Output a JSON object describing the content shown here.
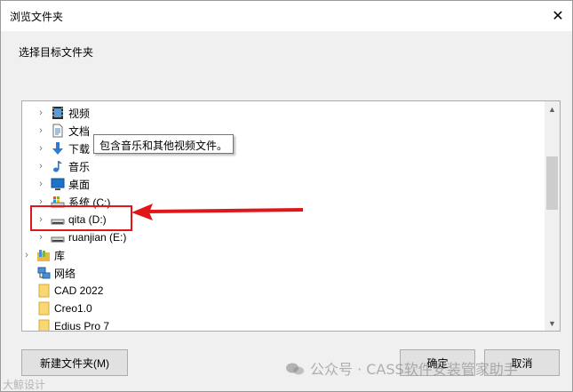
{
  "window": {
    "title": "浏览文件夹",
    "close_glyph": "✕"
  },
  "prompt": "选择目标文件夹",
  "tree": {
    "items": [
      {
        "label": "视频",
        "icon": "video-folder-icon",
        "expand": "›"
      },
      {
        "label": "文档",
        "icon": "documents-folder-icon",
        "expand": "›"
      },
      {
        "label": "下载",
        "icon": "downloads-folder-icon",
        "expand": "›"
      },
      {
        "label": "音乐",
        "icon": "music-folder-icon",
        "expand": "›"
      },
      {
        "label": "桌面",
        "icon": "desktop-folder-icon",
        "expand": "›"
      },
      {
        "label": "系统 (C:)",
        "icon": "system-drive-icon",
        "expand": "›"
      },
      {
        "label": "qita (D:)",
        "icon": "drive-icon",
        "expand": "›"
      },
      {
        "label": "ruanjian (E:)",
        "icon": "drive-icon",
        "expand": "›"
      },
      {
        "label": "库",
        "icon": "library-icon",
        "expand": "›"
      },
      {
        "label": "网络",
        "icon": "network-icon",
        "expand": ""
      },
      {
        "label": "CAD 2022",
        "icon": "folder-icon",
        "expand": ""
      },
      {
        "label": "Creo1.0",
        "icon": "folder-icon",
        "expand": ""
      },
      {
        "label": "Edius Pro 7",
        "icon": "folder-icon",
        "expand": ""
      }
    ],
    "tooltip": "包含音乐和其他视频文件。"
  },
  "buttons": {
    "new_folder": "新建文件夹(M)",
    "ok": "确定",
    "cancel": "取消"
  },
  "watermark": {
    "right": "公众号 · CASS软件安装管家助手",
    "left": "大鲸设计"
  },
  "colors": {
    "highlight": "#e0161b"
  }
}
